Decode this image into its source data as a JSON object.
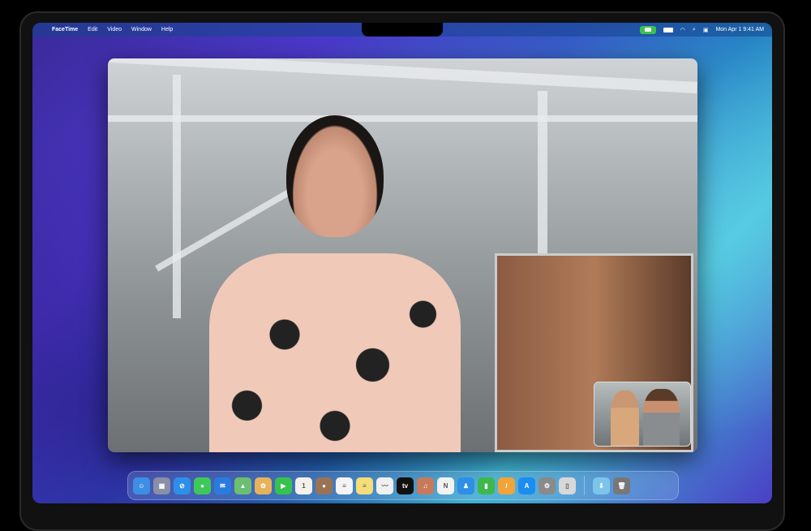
{
  "menubar": {
    "app_name": "FaceTime",
    "menus": [
      "Edit",
      "Video",
      "Window",
      "Help"
    ],
    "datetime": "Mon Apr 1  9:41 AM"
  },
  "dock": {
    "apps": [
      {
        "name": "Finder",
        "color": "#3d8fe6",
        "glyph": "☺"
      },
      {
        "name": "Launchpad",
        "color": "#8a8fa8",
        "glyph": "▦"
      },
      {
        "name": "Safari",
        "color": "#2e8fe8",
        "glyph": "⊘"
      },
      {
        "name": "Messages",
        "color": "#3fc85a",
        "glyph": "●"
      },
      {
        "name": "Mail",
        "color": "#2a7be0",
        "glyph": "✉"
      },
      {
        "name": "Maps",
        "color": "#6cbf70",
        "glyph": "▲"
      },
      {
        "name": "Photos",
        "color": "#e8b25a",
        "glyph": "✿"
      },
      {
        "name": "FaceTime",
        "color": "#38c24d",
        "glyph": "▶"
      },
      {
        "name": "Calendar",
        "color": "#f4f1ea",
        "glyph": "1"
      },
      {
        "name": "Contacts",
        "color": "#9a7256",
        "glyph": "●"
      },
      {
        "name": "Reminders",
        "color": "#f4f4f4",
        "glyph": "≡"
      },
      {
        "name": "Notes",
        "color": "#f6dd7a",
        "glyph": "≡"
      },
      {
        "name": "Freeform",
        "color": "#f0f0f0",
        "glyph": "〰"
      },
      {
        "name": "TV",
        "color": "#111111",
        "glyph": "tv"
      },
      {
        "name": "Music",
        "color": "#c77a5a",
        "glyph": "♫"
      },
      {
        "name": "News",
        "color": "#f2f2f2",
        "glyph": "N"
      },
      {
        "name": "Keynote",
        "color": "#2f8ee6",
        "glyph": "♟"
      },
      {
        "name": "Numbers",
        "color": "#3eb84c",
        "glyph": "▮"
      },
      {
        "name": "Pages",
        "color": "#f0a43a",
        "glyph": "/"
      },
      {
        "name": "App Store",
        "color": "#1c8cf0",
        "glyph": "A"
      },
      {
        "name": "System Settings",
        "color": "#8a8a8a",
        "glyph": "⚙"
      },
      {
        "name": "iPhone Mirroring",
        "color": "#d8d8d8",
        "glyph": "▯"
      }
    ],
    "stack": {
      "name": "Downloads",
      "color": "#7cc4ea",
      "glyph": "⬇"
    },
    "trash": {
      "name": "Trash",
      "color": "#777777",
      "glyph": "🗑"
    }
  }
}
